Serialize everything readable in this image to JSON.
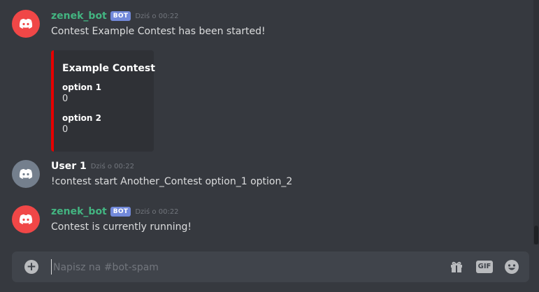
{
  "messages": [
    {
      "username": "zenek_bot",
      "badge": "BOT",
      "timestamp": "Dziś o 00:22",
      "text": "Contest Example Contest has been started!",
      "embed": {
        "title": "Example Contest",
        "fields": [
          {
            "name": "option 1",
            "value": "0"
          },
          {
            "name": "option 2",
            "value": "0"
          }
        ]
      }
    },
    {
      "username": "User 1",
      "timestamp": "Dziś o 00:22",
      "text": "!contest start Another_Contest option_1 option_2"
    },
    {
      "username": "zenek_bot",
      "badge": "BOT",
      "timestamp": "Dziś o 00:22",
      "text": "Contest is currently running!"
    }
  ],
  "composer": {
    "placeholder": "Napisz na #bot-spam",
    "gif_label": "GIF"
  },
  "colors": {
    "background": "#36393f",
    "bot_name": "#43b581",
    "user_name": "#ffffff",
    "bot_avatar": "#f04747",
    "user_avatar": "#747f8d",
    "bot_badge": "#7289da",
    "embed_border": "#e60000"
  },
  "icons": {
    "avatar": "discord-logo-icon",
    "add": "plus-circle-icon",
    "gift": "gift-icon",
    "gif": "gif-icon",
    "emoji": "emoji-icon"
  }
}
